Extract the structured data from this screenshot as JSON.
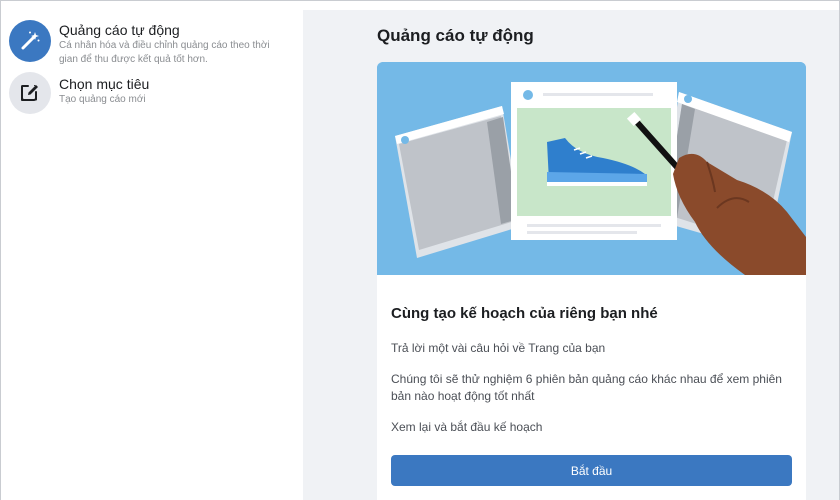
{
  "sidebar": {
    "items": [
      {
        "title": "Quảng cáo tự động",
        "description": "Cá nhân hóa và điều chỉnh quảng cáo theo thời gian để thu được kết quả tốt hơn.",
        "icon": "magic-wand-icon",
        "active": true
      },
      {
        "title": "Chọn mục tiêu",
        "description": "Tạo quảng cáo mới",
        "icon": "edit-icon",
        "active": false
      }
    ]
  },
  "main": {
    "title": "Quảng cáo tự động",
    "card": {
      "heading": "Cùng tạo kế hoạch của riêng bạn nhé",
      "paragraphs": [
        "Trả lời một vài câu hỏi về Trang của bạn",
        "Chúng tôi sẽ thử nghiệm 6 phiên bản quảng cáo khác nhau để xem phiên bản nào hoạt động tốt nhất",
        "Xem lại và bắt đầu kế hoạch"
      ],
      "button_label": "Bắt đầu"
    }
  },
  "colors": {
    "accent": "#3b78c1",
    "active_icon_bg": "#3b78c1",
    "inactive_icon_bg": "#e4e6eb",
    "hero_bg": "#74b9e7",
    "page_bg": "#f0f2f5"
  }
}
